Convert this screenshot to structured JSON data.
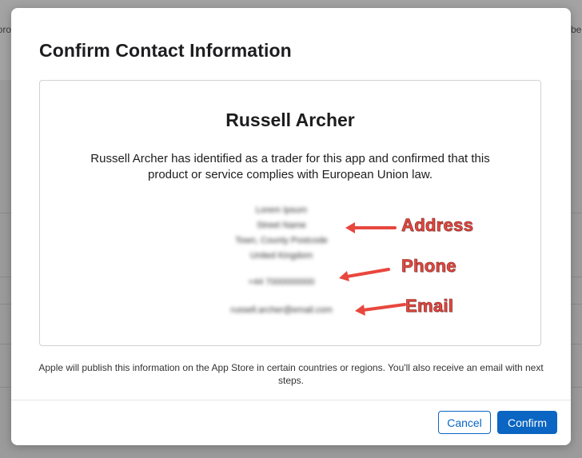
{
  "background": {
    "left_fragment": "oro",
    "right_fragment": "be"
  },
  "modal": {
    "title": "Confirm Contact Information",
    "trader": {
      "name": "Russell Archer",
      "description": "Russell Archer has identified as a trader for this app and confirmed that this product or service complies with European Union law.",
      "address_lines": [
        "Lorem Ipsum",
        "Street Name",
        "Town, County Postcode",
        "United Kingdom"
      ],
      "phone": "+44 7000000000",
      "email": "russell.archer@email.com"
    },
    "annotations": {
      "address": "Address",
      "phone": "Phone",
      "email": "Email",
      "color": "#e8473e"
    },
    "footer_note": "Apple will publish this information on the App Store in certain countries or regions. You'll also receive an email with next steps.",
    "buttons": {
      "cancel": "Cancel",
      "confirm": "Confirm"
    },
    "colors": {
      "accent": "#0b65c2"
    }
  }
}
